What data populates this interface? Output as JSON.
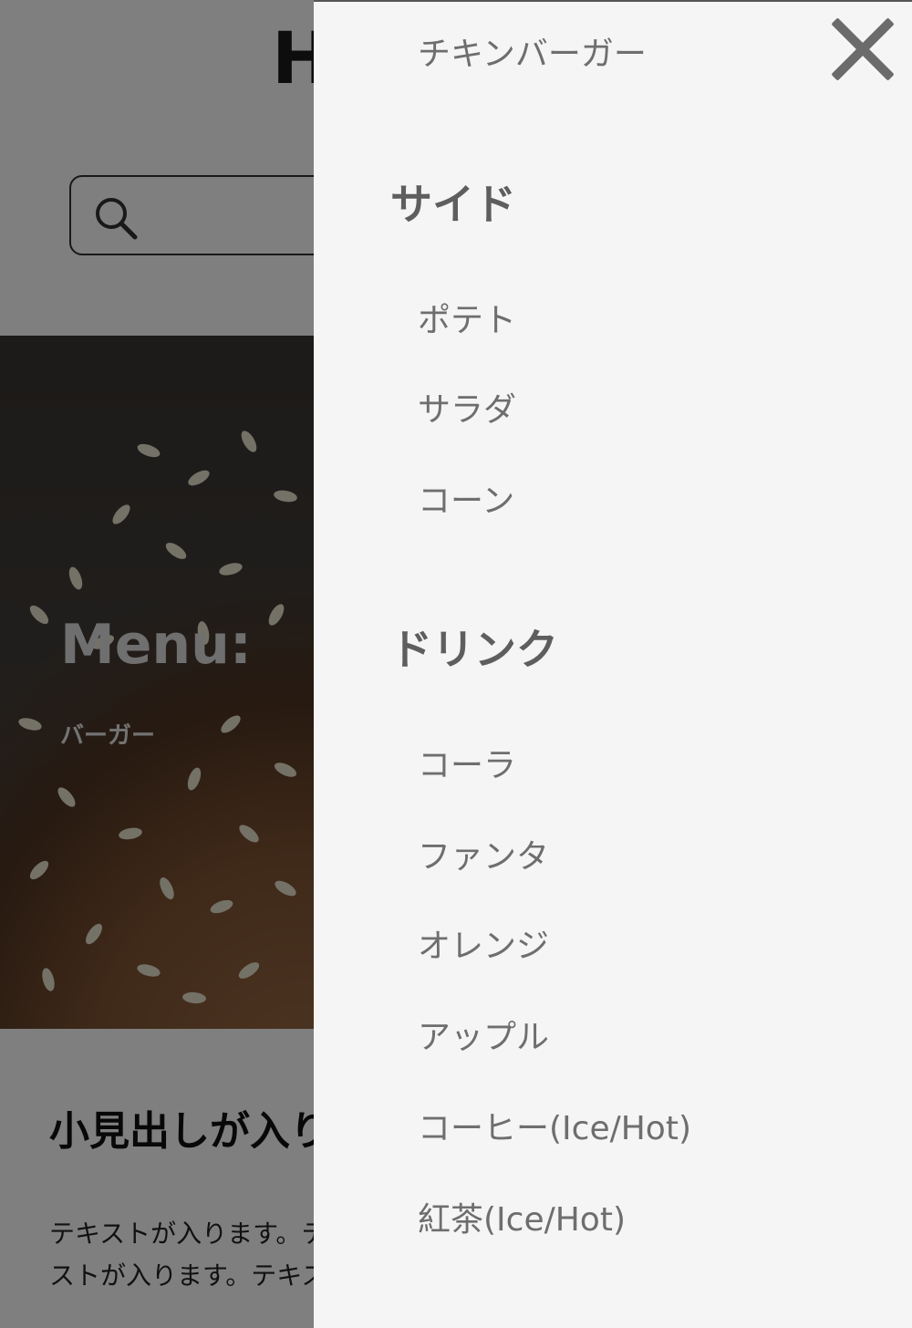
{
  "page": {
    "logo": "H",
    "hero_title": "Menu:",
    "hero_subtitle": "バーガー",
    "sub_heading": "小見出しが入ります",
    "body_text": "テキストが入ります。テキストが入ります。テキストが入ります。テキストが入ります。テキストが入ります。テキスト"
  },
  "drawer": {
    "burger_items": [
      "チキンバーガー"
    ],
    "side_heading": "サイド",
    "side_items": [
      "ポテト",
      "サラダ",
      "コーン"
    ],
    "drink_heading": "ドリンク",
    "drink_items": [
      "コーラ",
      "ファンタ",
      "オレンジ",
      "アップル",
      "コーヒー(Ice/Hot)",
      "紅茶(Ice/Hot)"
    ]
  },
  "colors": {
    "drawer_bg": "#f5f5f5",
    "overlay": "rgba(0,0,0,0.5)",
    "item_text": "#6e6e6e",
    "category_text": "#5e5e5e"
  },
  "icons": [
    "search-icon",
    "close-icon"
  ]
}
